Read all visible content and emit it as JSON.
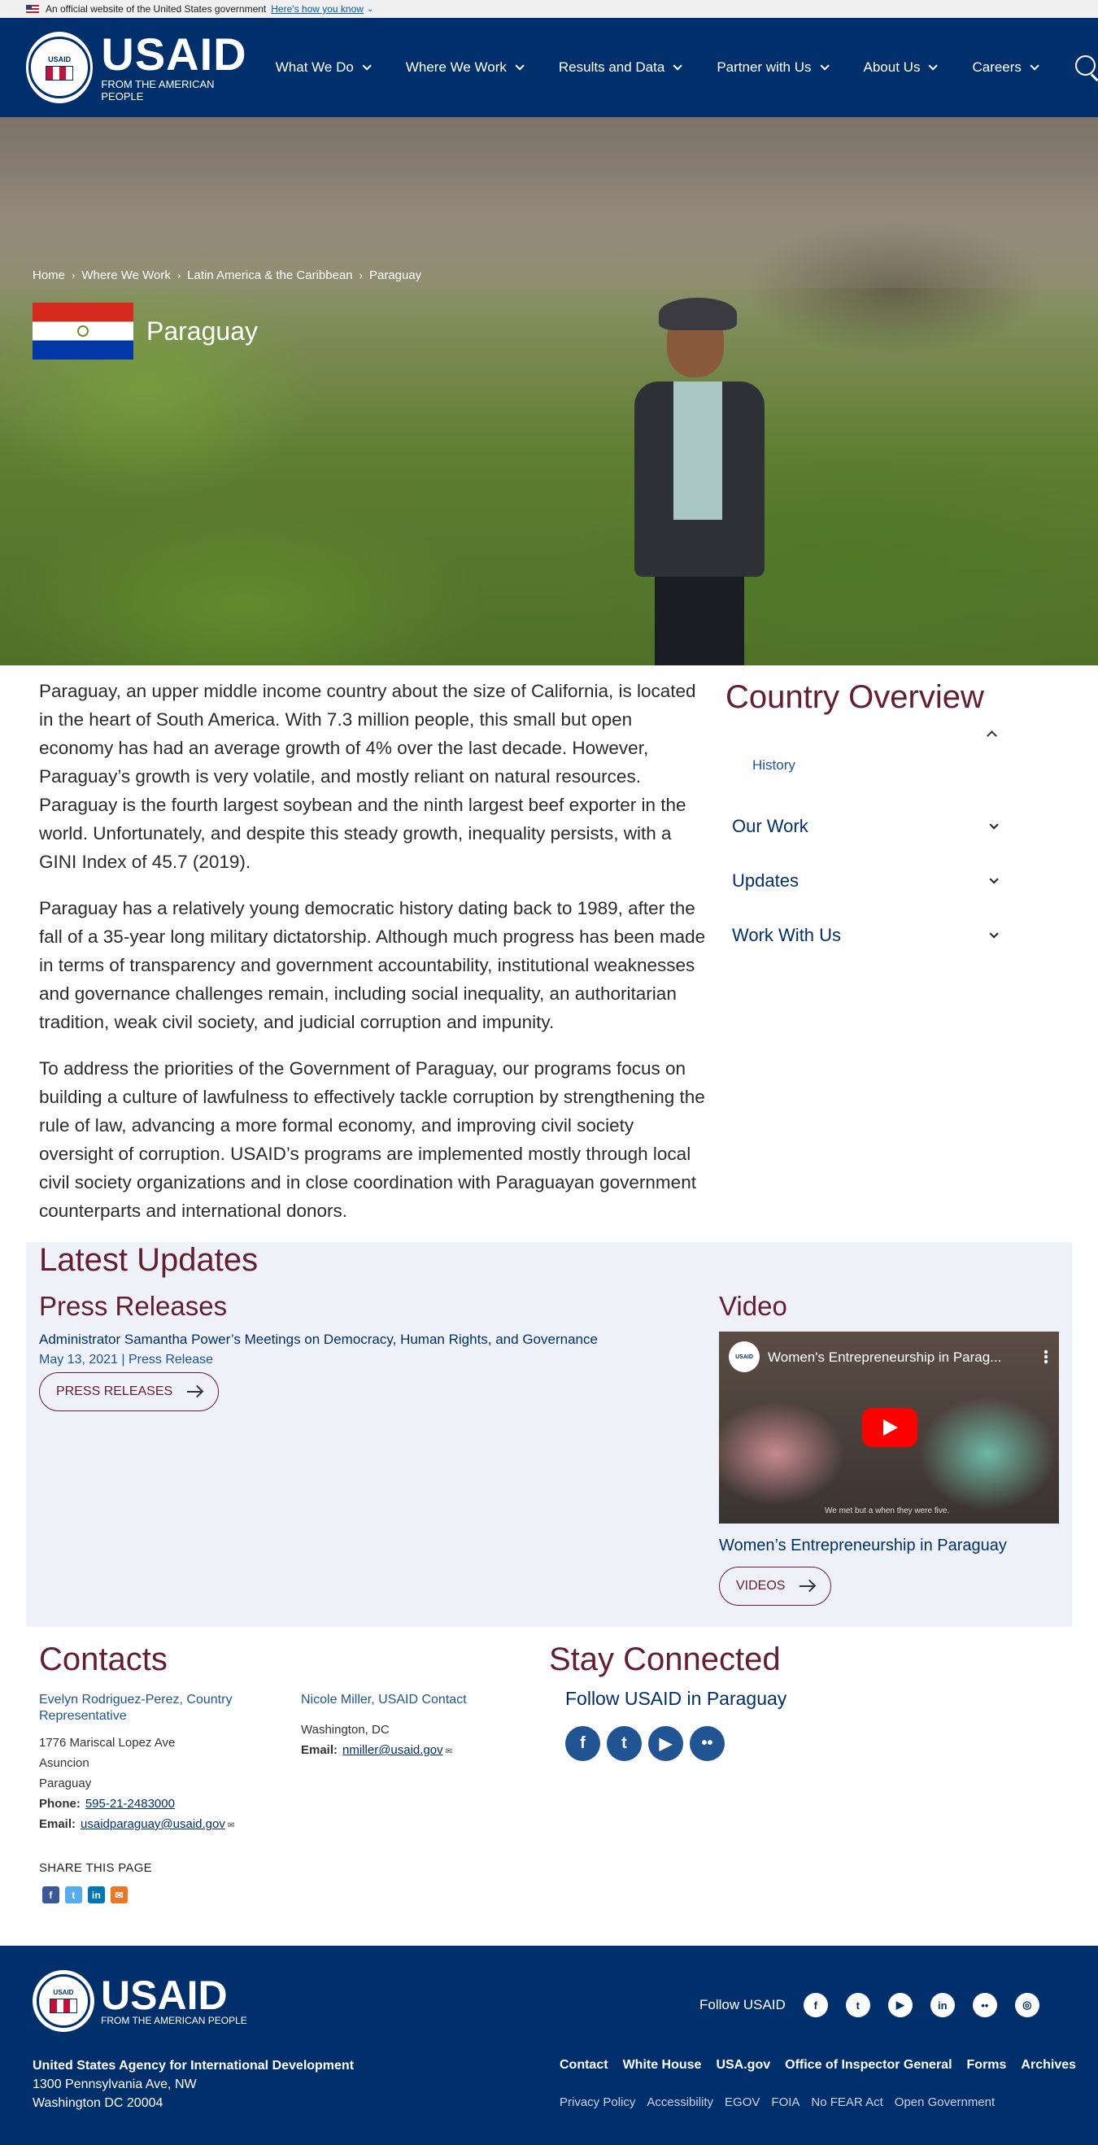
{
  "gov_banner": {
    "text": "An official website of the United States government",
    "link": "Here's how you know"
  },
  "header": {
    "seal_text": "USAID",
    "brand": "USAID",
    "tagline": "FROM THE AMERICAN PEOPLE",
    "nav": [
      "What We Do",
      "Where We Work",
      "Results and Data",
      "Partner with Us",
      "About Us",
      "Careers"
    ]
  },
  "breadcrumb": [
    "Home",
    "Where We Work",
    "Latin America & the Caribbean",
    "Paraguay"
  ],
  "page_title": "Paraguay",
  "intro": [
    "Paraguay, an upper middle income country about the size of California, is located in the heart of South America. With 7.3 million people, this small but open economy has had an average growth of 4% over the last decade. However, Paraguay’s growth is very volatile, and mostly reliant on natural resources. Paraguay is the fourth largest soybean and the ninth largest beef exporter in the world.  Unfortunately, and despite this steady growth, inequality persists, with a GINI Index of 45.7 (2019).",
    "Paraguay has a relatively young democratic history dating back to 1989, after the fall of a 35-year long military dictatorship.  Although much progress has been made in terms of transparency and government accountability, institutional weaknesses and governance challenges remain, including social inequality, an authoritarian tradition, weak civil society, and judicial corruption and impunity.",
    "To address the priorities of the Government of Paraguay, our programs focus on building a culture of lawfulness to effectively tackle corruption by strengthening the rule of law, advancing a more formal economy, and improving civil society oversight of corruption. USAID’s programs are implemented mostly through local civil society organizations and in close coordination with Paraguayan government counterparts and international donors."
  ],
  "overview": {
    "title": "Country Overview",
    "sub_link": "History",
    "items": [
      "Our Work",
      "Updates",
      "Work With Us"
    ]
  },
  "updates": {
    "title": "Latest Updates",
    "press": {
      "heading": "Press Releases",
      "item_title": "Administrator Samantha Power’s Meetings on Democracy, Human Rights, and Governance",
      "item_meta": "May 13, 2021 | Press Release",
      "button": "PRESS RELEASES"
    },
    "video": {
      "heading": "Video",
      "player_title": "Women's Entrepreneurship in Parag...",
      "player_caption": "We met but a when they were five.",
      "video_title": "Women’s Entrepreneurship in Paraguay",
      "button": "VIDEOS"
    }
  },
  "contacts": {
    "title": "Contacts",
    "people": [
      {
        "name": "Evelyn Rodriguez-Perez, Country Representative",
        "lines": [
          "1776 Mariscal Lopez Ave",
          "Asuncion",
          "Paraguay"
        ],
        "phone_label": "Phone:",
        "phone": "595-21-2483000",
        "email_label": "Email:",
        "email": "usaidparaguay@usaid.gov"
      },
      {
        "name": "Nicole Miller, USAID Contact",
        "lines": [
          "Washington, DC"
        ],
        "email_label": "Email:",
        "email": "nmiller@usaid.gov"
      }
    ],
    "share_label": "SHARE THIS PAGE"
  },
  "stay": {
    "title": "Stay Connected",
    "follow": "Follow USAID in Paraguay"
  },
  "footer": {
    "brand": "USAID",
    "tagline": "FROM THE AMERICAN PEOPLE",
    "follow": "Follow USAID",
    "org": "United States Agency for International Development",
    "addr1": "1300 Pennsylvania Ave, NW",
    "addr2": "Washington DC 20004",
    "links": [
      "Contact",
      "White House",
      "USA.gov",
      "Office of Inspector General",
      "Forms",
      "Archives"
    ],
    "links2": [
      "Privacy Policy",
      "Accessibility",
      "EGOV",
      "FOIA",
      "No FEAR Act",
      "Open Government"
    ]
  },
  "colors": {
    "navy": "#002f6c",
    "maroon": "#651d32",
    "link": "#205493",
    "updates_bg": "#eef2f8"
  }
}
